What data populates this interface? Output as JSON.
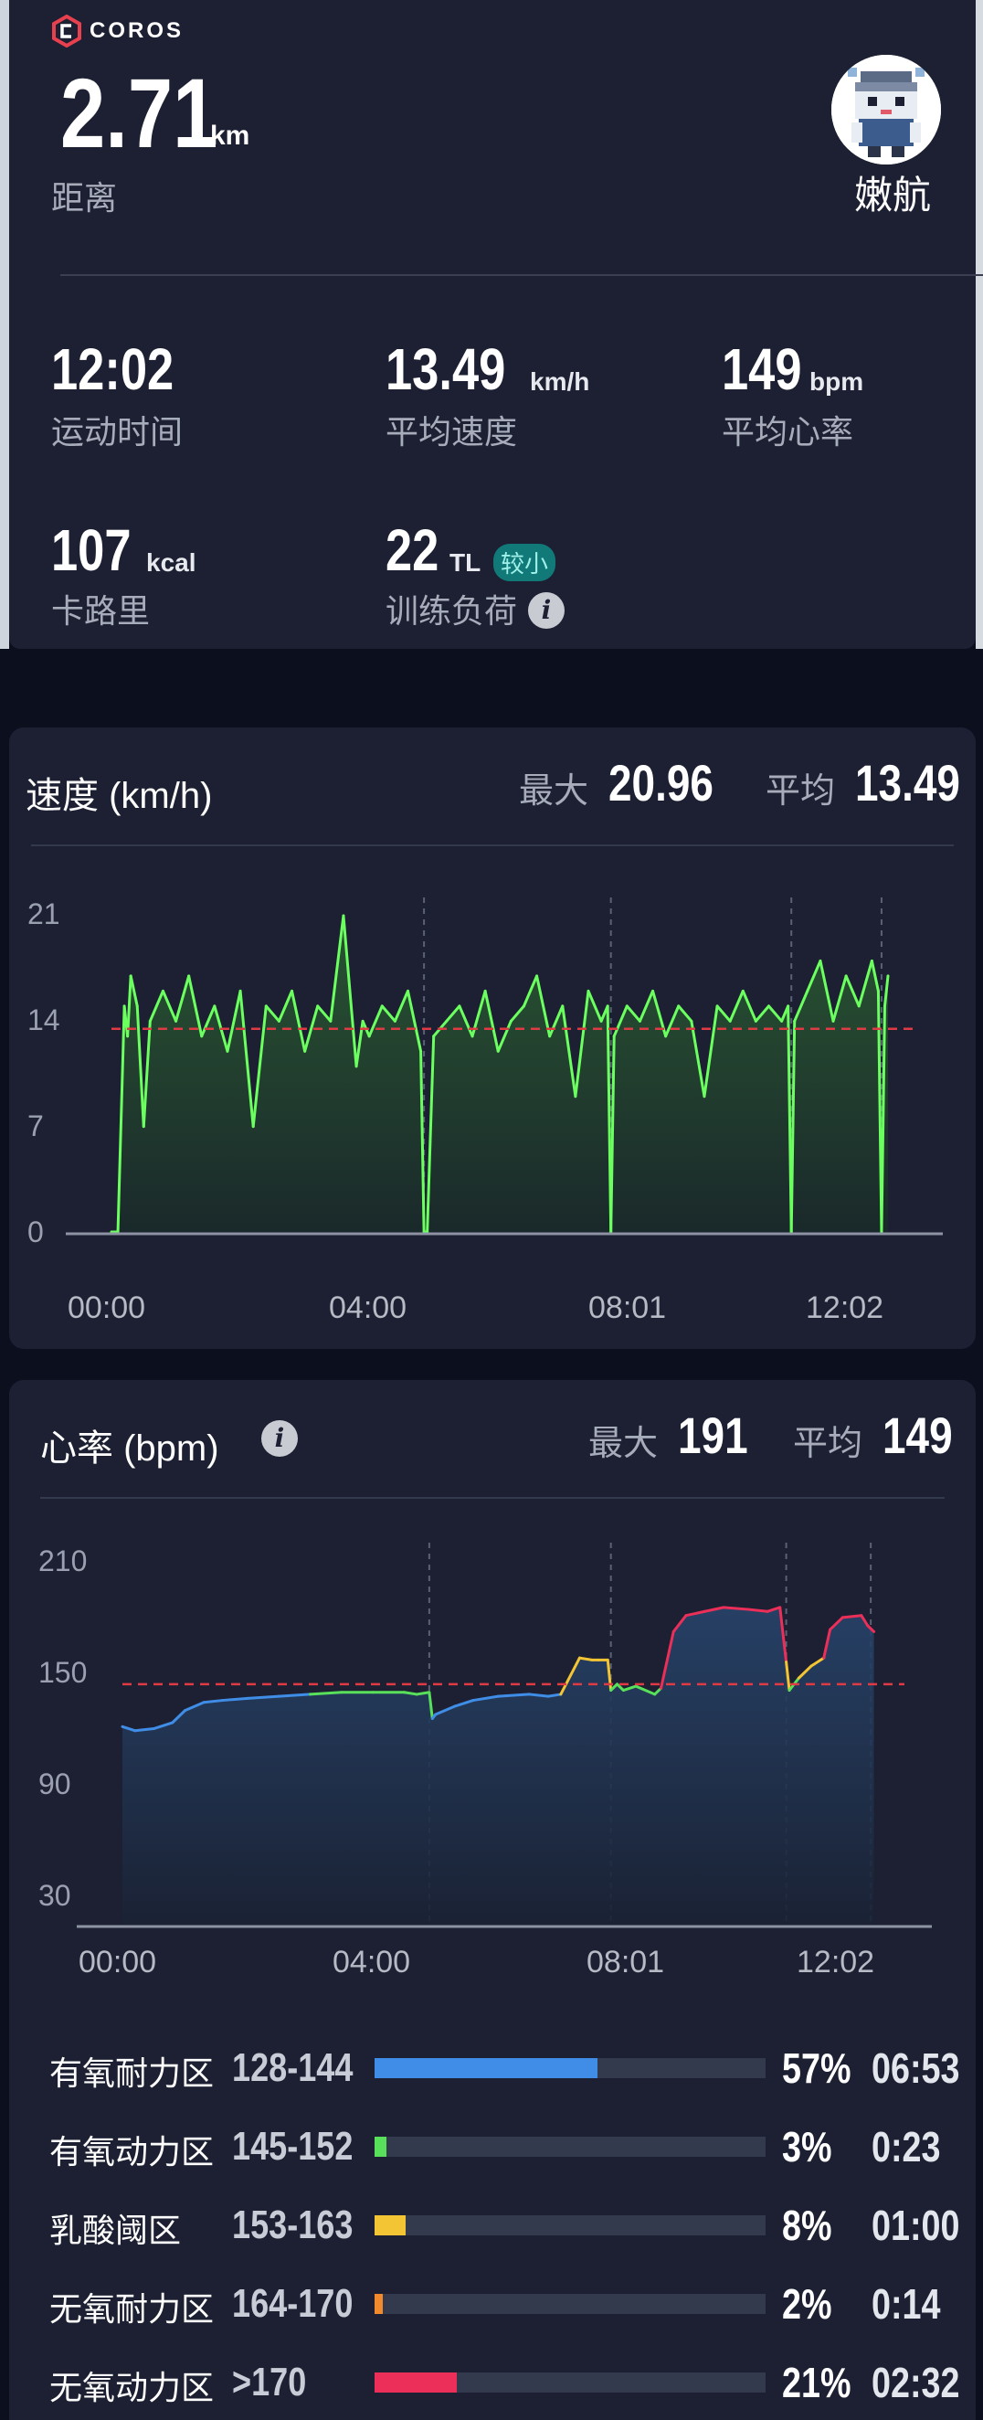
{
  "header": {
    "brand": "COROS",
    "distance_value": "2.71",
    "distance_unit": "km",
    "distance_label": "距离",
    "username": "嫩航"
  },
  "metrics": {
    "time_value": "12:02",
    "time_label": "运动时间",
    "speed_value": "13.49",
    "speed_unit": "km/h",
    "speed_label": "平均速度",
    "hr_value": "149",
    "hr_unit": "bpm",
    "hr_label": "平均心率",
    "cal_value": "107",
    "cal_unit": "kcal",
    "cal_label": "卡路里",
    "load_value": "22",
    "load_unit": "TL",
    "load_badge": "较小",
    "load_label": "训练负荷"
  },
  "speed_card": {
    "title": "速度 (km/h)",
    "max_label": "最大",
    "max_value": "20.96",
    "avg_label": "平均",
    "avg_value": "13.49"
  },
  "hr_card": {
    "title": "心率 (bpm)",
    "max_label": "最大",
    "max_value": "191",
    "avg_label": "平均",
    "avg_value": "149"
  },
  "zones": [
    {
      "name": "有氧耐力区",
      "range": "128-144",
      "fraction": 0.57,
      "pct": "57%",
      "time": "06:53",
      "color": "#3f8de6"
    },
    {
      "name": "有氧动力区",
      "range": "145-152",
      "fraction": 0.03,
      "pct": "3%",
      "time": "0:23",
      "color": "#59e05a"
    },
    {
      "name": "乳酸阈区",
      "range": "153-163",
      "fraction": 0.08,
      "pct": "8%",
      "time": "01:00",
      "color": "#f3c534"
    },
    {
      "name": "无氧耐力区",
      "range": "164-170",
      "fraction": 0.02,
      "pct": "2%",
      "time": "0:14",
      "color": "#f08a2c"
    },
    {
      "name": "无氧动力区",
      "range": ">170",
      "fraction": 0.21,
      "pct": "21%",
      "time": "02:32",
      "color": "#ec2f58"
    }
  ],
  "chart_data": [
    {
      "type": "line",
      "title": "速度 (km/h)",
      "y_ticks": [
        "21",
        "14",
        "7",
        "0"
      ],
      "ylim": [
        0,
        21
      ],
      "x_ticks": [
        "00:00",
        "04:00",
        "08:01",
        "12:02"
      ],
      "average": 13.49,
      "line_color": "#6bff5f",
      "x": [
        0,
        0.1,
        0.2,
        0.25,
        0.3,
        0.4,
        0.5,
        0.6,
        0.8,
        1.0,
        1.2,
        1.4,
        1.6,
        1.8,
        2.0,
        2.2,
        2.4,
        2.6,
        2.8,
        3.0,
        3.2,
        3.4,
        3.6,
        3.8,
        3.9,
        4.0,
        4.2,
        4.4,
        4.6,
        4.8,
        4.85,
        4.9,
        5.0,
        5.2,
        5.4,
        5.6,
        5.8,
        6.0,
        6.2,
        6.4,
        6.6,
        6.8,
        7.0,
        7.2,
        7.4,
        7.6,
        7.7,
        7.75,
        7.8,
        8.0,
        8.2,
        8.4,
        8.6,
        8.8,
        9.0,
        9.2,
        9.4,
        9.6,
        9.8,
        10.0,
        10.2,
        10.4,
        10.5,
        10.55,
        10.6,
        10.8,
        11.0,
        11.2,
        11.4,
        11.6,
        11.8,
        11.9,
        11.95,
        12.0,
        12.05
      ],
      "y": [
        0,
        0,
        15,
        13,
        17,
        15,
        7,
        14,
        16,
        14,
        17,
        13,
        15,
        12,
        16,
        7,
        15,
        14,
        16,
        12,
        15,
        14,
        21,
        11,
        14,
        13,
        15,
        14,
        16,
        12,
        0,
        0,
        13,
        14,
        15,
        13,
        16,
        12,
        14,
        15,
        17,
        13,
        15,
        9,
        16,
        14,
        15,
        0,
        13,
        15,
        14,
        16,
        13,
        15,
        14,
        9,
        15,
        14,
        16,
        14,
        15,
        14,
        15,
        0,
        14,
        16,
        18,
        14,
        17,
        15,
        18,
        16,
        0,
        15,
        17
      ]
    },
    {
      "type": "line",
      "title": "心率 (bpm)",
      "y_ticks": [
        "210",
        "150",
        "90",
        "30"
      ],
      "ylim": [
        30,
        210
      ],
      "x_ticks": [
        "00:00",
        "04:00",
        "08:01",
        "12:02"
      ],
      "average": 149,
      "x": [
        0,
        0.2,
        0.5,
        0.8,
        1.0,
        1.3,
        1.6,
        2.0,
        2.5,
        3.0,
        3.5,
        4.0,
        4.5,
        4.7,
        4.9,
        4.95,
        5.0,
        5.3,
        5.6,
        6.0,
        6.5,
        6.8,
        7.0,
        7.3,
        7.5,
        7.6,
        7.75,
        7.8,
        7.9,
        8.0,
        8.2,
        8.5,
        8.6,
        8.8,
        9.0,
        9.3,
        9.6,
        10.0,
        10.3,
        10.5,
        10.6,
        10.65,
        10.8,
        11.0,
        11.2,
        11.3,
        11.5,
        11.8,
        11.9,
        12.0
      ],
      "y": [
        128,
        126,
        127,
        130,
        136,
        140,
        141,
        142,
        143,
        144,
        145,
        145,
        145,
        144,
        145,
        132,
        134,
        138,
        141,
        143,
        144,
        143,
        144,
        162,
        161,
        161,
        161,
        146,
        149,
        146,
        148,
        144,
        147,
        175,
        183,
        185,
        187,
        186,
        185,
        187,
        160,
        146,
        152,
        158,
        162,
        176,
        182,
        183,
        178,
        175
      ]
    }
  ]
}
